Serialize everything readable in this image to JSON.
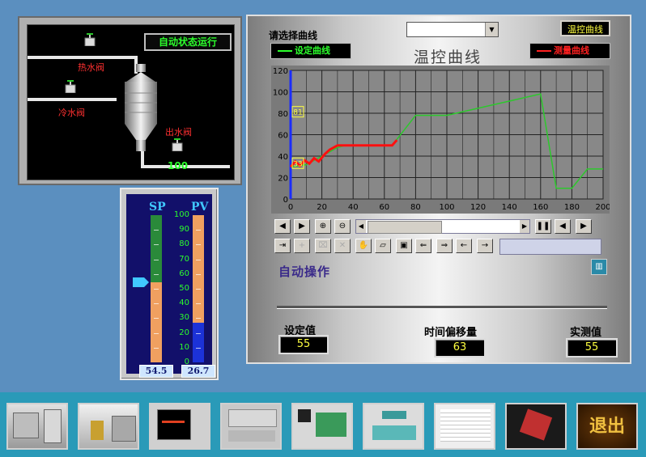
{
  "process_panel": {
    "status": "自动状态运行",
    "hot_valve_label": "热水阀",
    "cold_valve_label": "冷水阀",
    "out_valve_label": "出水阀",
    "out_value": "100"
  },
  "bars": {
    "sp_title": "SP",
    "pv_title": "PV",
    "scale": [
      "100",
      "90",
      "80",
      "70",
      "60",
      "50",
      "40",
      "30",
      "20",
      "10",
      "0"
    ],
    "sp_value": "54.5",
    "pv_value": "26.7",
    "sp_level": 54.5,
    "pv_level": 26.7,
    "colors": {
      "sp_fill": "#f0a060",
      "sp_empty": "#2a8a3a",
      "pv_fill": "#1c32d8",
      "pv_empty": "#f0a060"
    }
  },
  "curve_panel": {
    "select_label": "请选择曲线",
    "dropdown_value": "",
    "temp_curve_button": "温控曲线",
    "set_curve_legend": "设定曲线",
    "measure_curve_legend": "测量曲线",
    "title": "温控曲线",
    "auto_op": "自动操作",
    "set_value_label": "设定值",
    "set_value": "55",
    "offset_label": "时间偏移量",
    "offset_value": "63",
    "measured_label": "实测值",
    "measured_value": "55",
    "chart_markers": [
      "81",
      "33"
    ]
  },
  "chart_data": {
    "type": "line",
    "xlim": [
      0,
      200
    ],
    "ylim": [
      0,
      120
    ],
    "x_ticks": [
      "0",
      "20",
      "40",
      "60",
      "80",
      "100",
      "120",
      "140",
      "160",
      "180",
      "200"
    ],
    "y_ticks": [
      "0",
      "20",
      "40",
      "60",
      "80",
      "100",
      "120"
    ],
    "grid": true,
    "series": [
      {
        "name": "设定曲线",
        "color": "#2cc82c",
        "x": [
          0,
          10,
          20,
          30,
          35,
          65,
          80,
          100,
          160,
          170,
          180,
          190,
          200
        ],
        "y": [
          30,
          32,
          40,
          48,
          50,
          50,
          78,
          78,
          98,
          10,
          10,
          28,
          28
        ]
      },
      {
        "name": "测量曲线",
        "color": "#ff1010",
        "x": [
          0,
          3,
          6,
          9,
          12,
          15,
          18,
          22,
          25,
          30,
          40,
          50,
          60,
          65,
          68
        ],
        "y": [
          30,
          35,
          31,
          36,
          33,
          38,
          35,
          42,
          46,
          50,
          50,
          50,
          50,
          50,
          55
        ]
      }
    ]
  },
  "toolbar": {
    "row1": [
      "scroll-left",
      "scroll-right",
      "zoom-in",
      "zoom-out"
    ],
    "row1b": [
      "pause",
      "step-back",
      "step-forward"
    ],
    "row2": [
      "export",
      "add",
      "cut",
      "delete",
      "hand",
      "open-folder",
      "save",
      "prev",
      "next",
      "back",
      "forward"
    ]
  },
  "thumbnails": [
    "画面1",
    "画面2",
    "画面3",
    "画面4",
    "画面5",
    "画面6",
    "画面7",
    "画面8"
  ],
  "exit_label": "退出"
}
